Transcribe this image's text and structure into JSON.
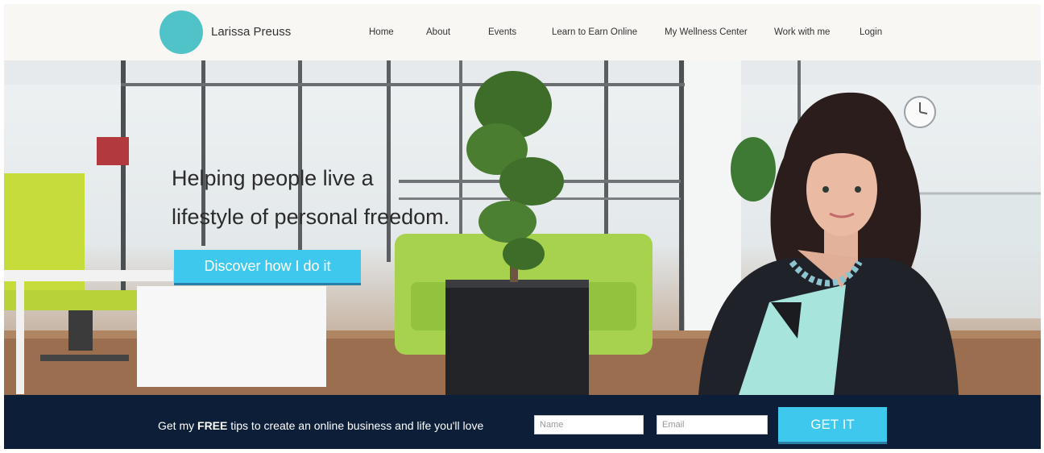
{
  "brand": {
    "name": "Larissa Preuss",
    "accent_color": "#4fc3c8"
  },
  "nav": {
    "items": [
      {
        "label": "Home"
      },
      {
        "label": "About"
      },
      {
        "label": "Events"
      },
      {
        "label": "Learn to Earn Online"
      },
      {
        "label": "My Wellness Center"
      },
      {
        "label": "Work with me"
      },
      {
        "label": "Login"
      }
    ]
  },
  "hero": {
    "headline_line1": "Helping people live a",
    "headline_line2": "lifestyle of personal freedom.",
    "cta_label": "Discover how I do it"
  },
  "signup": {
    "prefix": "Get my ",
    "emphasis": "FREE",
    "suffix": " tips to create an online business and life you'll love",
    "name_placeholder": "Name",
    "email_placeholder": "Email",
    "submit_label": "GET IT"
  },
  "colors": {
    "button": "#3fc8ee",
    "signup_bar": "#0c1e38",
    "header_bg": "#f8f7f4"
  }
}
